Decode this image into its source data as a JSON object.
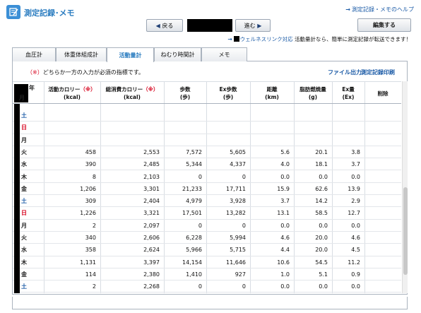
{
  "header": {
    "title": "測定記録･メモ",
    "help_link": "測定記録・メモのヘルプ"
  },
  "nav": {
    "back_label": "戻る",
    "next_label": "進む",
    "back_icon": "triangle-left-icon",
    "next_icon": "triangle-right-icon"
  },
  "edit_button": "編集する",
  "notice": {
    "part1": "ウェルネスリンク対応",
    "part2": "活動量計なら、簡単に測定記録が転送できます！"
  },
  "tabs": [
    {
      "label": "血圧計"
    },
    {
      "label": "体重体組成計"
    },
    {
      "label": "活動量計"
    },
    {
      "label": "ねむり時間計"
    },
    {
      "label": "メモ"
    }
  ],
  "active_tab": "活動量計",
  "panel": {
    "required_mark": "（※）",
    "required_text": "どちらか一方の入力が必須の指標です。",
    "file_output": "ファイル出力",
    "print_link": "測定記録印刷"
  },
  "table": {
    "year_suffix": "年",
    "month_suffix": "月",
    "headers": [
      {
        "l1": "活動カロリー",
        "mark": "（※）",
        "l2": "(kcal)"
      },
      {
        "l1": "総消費カロリー",
        "mark": "（※）",
        "l2": "(kcal)"
      },
      {
        "l1": "歩数",
        "mark": "",
        "l2": "(歩)"
      },
      {
        "l1": "Ex歩数",
        "mark": "",
        "l2": "(歩)"
      },
      {
        "l1": "距離",
        "mark": "",
        "l2": "(km)"
      },
      {
        "l1": "脂肪燃焼量",
        "mark": "",
        "l2": "(g)"
      },
      {
        "l1": "Ex量",
        "mark": "",
        "l2": "(Ex)"
      },
      {
        "l1": "削除",
        "mark": "",
        "l2": ""
      }
    ],
    "rows": [
      {
        "day": "土",
        "type": "sat",
        "v": [
          "",
          "",
          "",
          "",
          "",
          "",
          ""
        ]
      },
      {
        "day": "日",
        "type": "sun",
        "v": [
          "",
          "",
          "",
          "",
          "",
          "",
          ""
        ]
      },
      {
        "day": "月",
        "type": "",
        "v": [
          "",
          "",
          "",
          "",
          "",
          "",
          ""
        ]
      },
      {
        "day": "火",
        "type": "",
        "v": [
          "458",
          "2,553",
          "7,572",
          "5,605",
          "5.6",
          "20.1",
          "3.8"
        ]
      },
      {
        "day": "水",
        "type": "",
        "v": [
          "390",
          "2,485",
          "5,344",
          "4,337",
          "4.0",
          "18.1",
          "3.7"
        ]
      },
      {
        "day": "木",
        "type": "",
        "v": [
          "8",
          "2,103",
          "0",
          "0",
          "0.0",
          "0.0",
          "0.0"
        ]
      },
      {
        "day": "金",
        "type": "",
        "v": [
          "1,206",
          "3,301",
          "21,233",
          "17,711",
          "15.9",
          "62.6",
          "13.9"
        ]
      },
      {
        "day": "土",
        "type": "sat",
        "v": [
          "309",
          "2,404",
          "4,979",
          "3,928",
          "3.7",
          "14.2",
          "2.9"
        ]
      },
      {
        "day": "日",
        "type": "sun",
        "v": [
          "1,226",
          "3,321",
          "17,501",
          "13,282",
          "13.1",
          "58.5",
          "12.7"
        ]
      },
      {
        "day": "月",
        "type": "",
        "v": [
          "2",
          "2,097",
          "0",
          "0",
          "0.0",
          "0.0",
          "0.0"
        ]
      },
      {
        "day": "火",
        "type": "",
        "v": [
          "340",
          "2,606",
          "6,228",
          "5,994",
          "4.6",
          "20.0",
          "4.6"
        ]
      },
      {
        "day": "水",
        "type": "",
        "v": [
          "358",
          "2,624",
          "5,966",
          "5,715",
          "4.4",
          "20.0",
          "4.5"
        ]
      },
      {
        "day": "木",
        "type": "",
        "v": [
          "1,131",
          "3,397",
          "14,154",
          "11,646",
          "10.6",
          "54.5",
          "11.2"
        ]
      },
      {
        "day": "金",
        "type": "",
        "v": [
          "114",
          "2,380",
          "1,410",
          "927",
          "1.0",
          "5.1",
          "0.9"
        ]
      },
      {
        "day": "土",
        "type": "sat",
        "v": [
          "2",
          "2,268",
          "0",
          "0",
          "0.0",
          "0.0",
          "0.0"
        ]
      }
    ]
  },
  "colors": {
    "accent": "#2a7cc0",
    "link": "#1a5aa6",
    "required": "#d6001c",
    "border": "#aab3be"
  }
}
